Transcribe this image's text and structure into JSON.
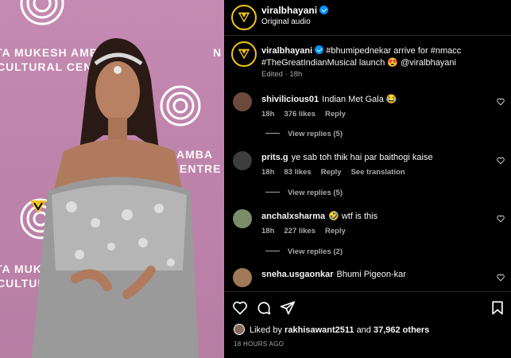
{
  "post": {
    "account": "viralbhayani",
    "audio": "Original audio",
    "caption_user": "viralbhayani",
    "caption_text_1": "#bhumipednekar arrive for #nmacc",
    "caption_text_2": "#TheGreatIndianMusical launch 😍 @viralbhayani",
    "caption_edited": "Edited",
    "caption_time": "18h"
  },
  "media": {
    "bg_line_1": "TA MUKESH AMBA",
    "bg_line_2": "CULTURAL CENTRE",
    "bg_line_3": "AMBA",
    "bg_line_4": "ENTRE",
    "bg_line_5": "TA MUKESH AMBA",
    "bg_line_6": "CULTURAL CENTR",
    "bg_line_7": "N"
  },
  "comments": [
    {
      "user": "shivilicious01",
      "text": "Indian Met Gala 😂",
      "time": "18h",
      "likes": "376 likes",
      "reply": "Reply",
      "translate": "",
      "replies": "View replies (5)"
    },
    {
      "user": "prits.g",
      "text": "ye sab toh thik hai par baithogi kaise",
      "time": "18h",
      "likes": "83 likes",
      "reply": "Reply",
      "translate": "See translation",
      "replies": "View replies (5)"
    },
    {
      "user": "anchalxsharma",
      "text": "🤣 wtf is this",
      "time": "18h",
      "likes": "227 likes",
      "reply": "Reply",
      "translate": "",
      "replies": "View replies (2)"
    },
    {
      "user": "sneha.usgaonkar",
      "text": "Bhumi Pigeon-kar",
      "time": "",
      "likes": "",
      "reply": "",
      "translate": "",
      "replies": ""
    }
  ],
  "footer": {
    "liked_prefix": "Liked by",
    "liked_user": "rakhisawant2511",
    "liked_and": "and",
    "liked_count": "37,962 others",
    "timestamp": "18 HOURS AGO"
  },
  "colors": {
    "verified": "#0095f6",
    "background": "#000000",
    "media_bg": "#c48ab1",
    "avatar_ring": "#f0c419"
  }
}
